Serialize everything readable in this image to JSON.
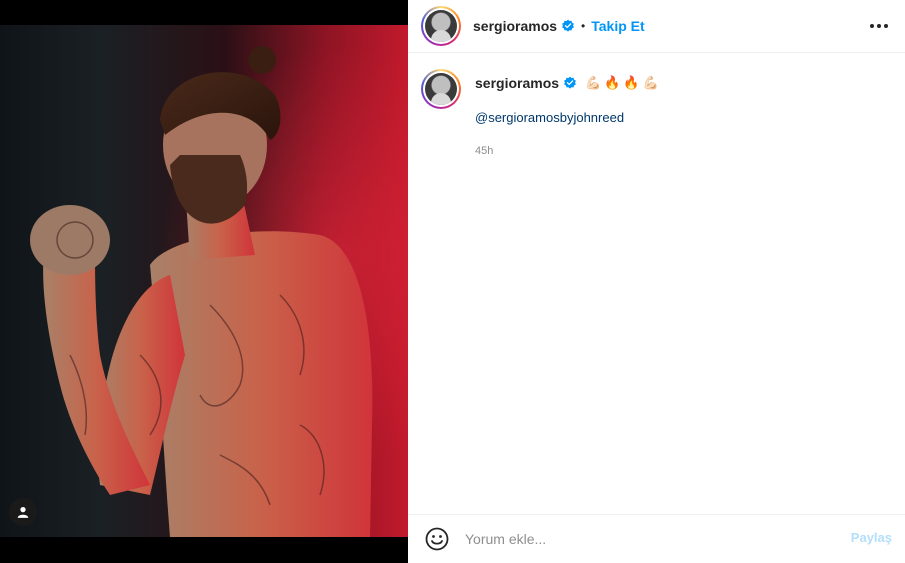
{
  "post": {
    "author": "sergioramos",
    "verified": true,
    "separator": "•",
    "follow_label": "Takip Et",
    "more_icon": "more-horizontal-icon"
  },
  "media": {
    "alt": "Tattooed man posing with raised fist under red light",
    "user_tag_icon": "person-icon"
  },
  "caption": {
    "author": "sergioramos",
    "emojis": "💪🏻🔥🔥💪🏻",
    "mention": "@sergioramosbyjohnreed",
    "time": "45h"
  },
  "comment": {
    "emoji_icon": "smiley-face-icon",
    "placeholder": "Yorum ekle...",
    "share_label": "Paylaş"
  },
  "colors": {
    "accent": "#0095f6",
    "share_disabled": "#b2dffc",
    "mention": "#00376b",
    "muted": "#8e8e8e"
  }
}
